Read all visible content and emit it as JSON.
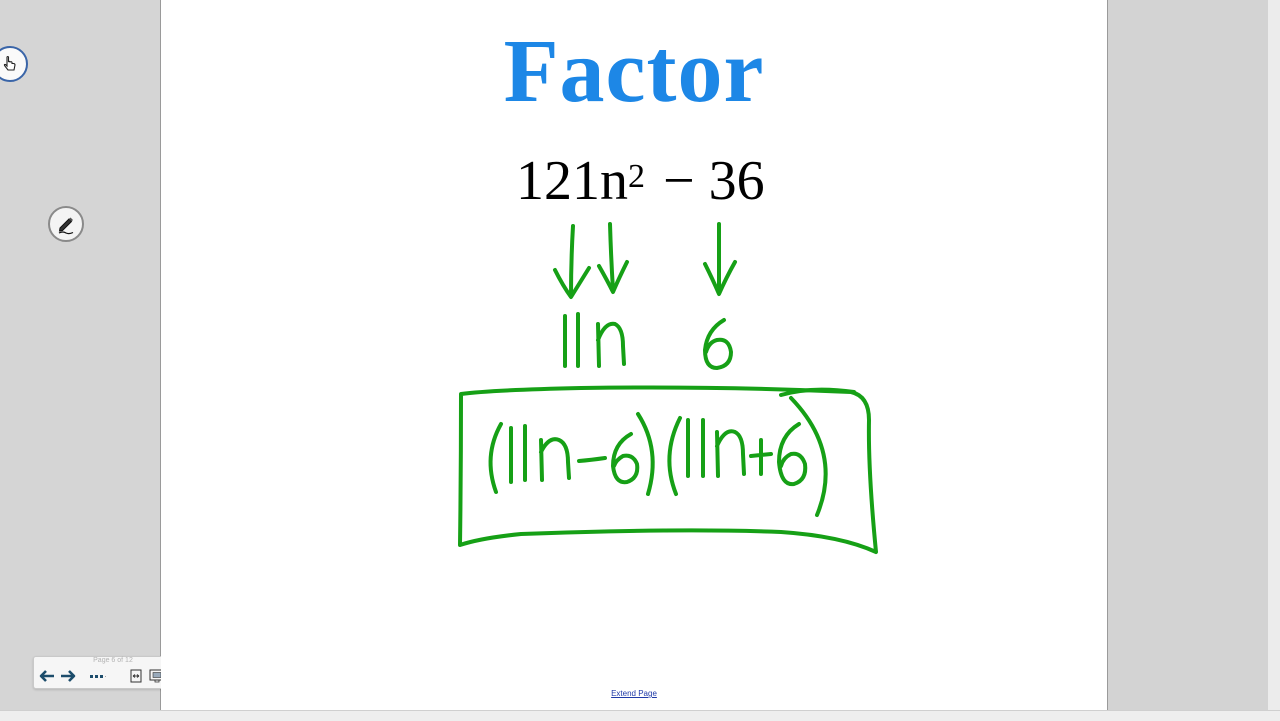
{
  "slide": {
    "title": "Factor",
    "expression": {
      "coefficient": "121n",
      "exponent": "2",
      "operator": "−",
      "constant": "36"
    },
    "handwriting": {
      "color": "#16a016",
      "terms": [
        "11n",
        "6"
      ],
      "factored_result": "(11n−6)(11n+6)"
    }
  },
  "footer": {
    "extend_page_label": "Extend Page"
  },
  "toolbar": {
    "page_indicator": "Page 6 of 12",
    "tools": [
      "pointer-icon",
      "pen-icon"
    ],
    "nav_buttons": [
      "arrow-left-icon",
      "arrow-right-icon",
      "more-icon",
      "fit-page-icon",
      "fullscreen-icon",
      "fit-width-icon"
    ]
  },
  "colors": {
    "title": "#1d87e6",
    "ink": "#16a016",
    "nav_icon": "#1c4c6b"
  }
}
